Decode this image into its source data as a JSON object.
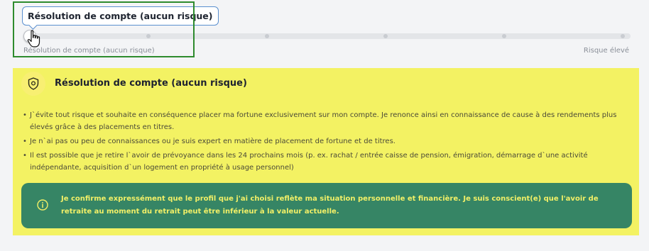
{
  "slider": {
    "tooltip": "Résolution de compte (aucun risque)",
    "label_left": "Résolution de compte (aucun risque)",
    "label_right": "Risque élevé",
    "steps": 6,
    "selected_step": 0
  },
  "card": {
    "title": "Résolution de compte (aucun risque)",
    "icon": "shield-icon",
    "bullets": [
      "J`évite tout risque et souhaite en conséquence placer ma fortune exclusivement sur mon compte. Je renonce ainsi en connaissance de cause à des rendements plus élevés grâce à des placements en titres.",
      "Je n`ai pas ou peu de connaissances ou je suis expert en matière de placement de fortune et de titres.",
      "Il est possible que je retire l`avoir de prévoyance dans les 24 prochains mois (p. ex. rachat / entrée caisse de pension, émigration, démarrage d`une activité indépendante, acquisition d`un logement en propriété à usage personnel)"
    ]
  },
  "notice": {
    "icon": "info-icon",
    "text": "Je confirme expressément que le profil que j'ai choisi reflète ma situation personnelle et financière. Je suis conscient(e) que l'avoir de retraite au moment du retrait peut être inférieur à la valeur actuelle."
  },
  "colors": {
    "card_bg": "#f3f263",
    "notice_bg": "#368565",
    "notice_text": "#f2f067",
    "highlight": "#2e8b2e"
  }
}
